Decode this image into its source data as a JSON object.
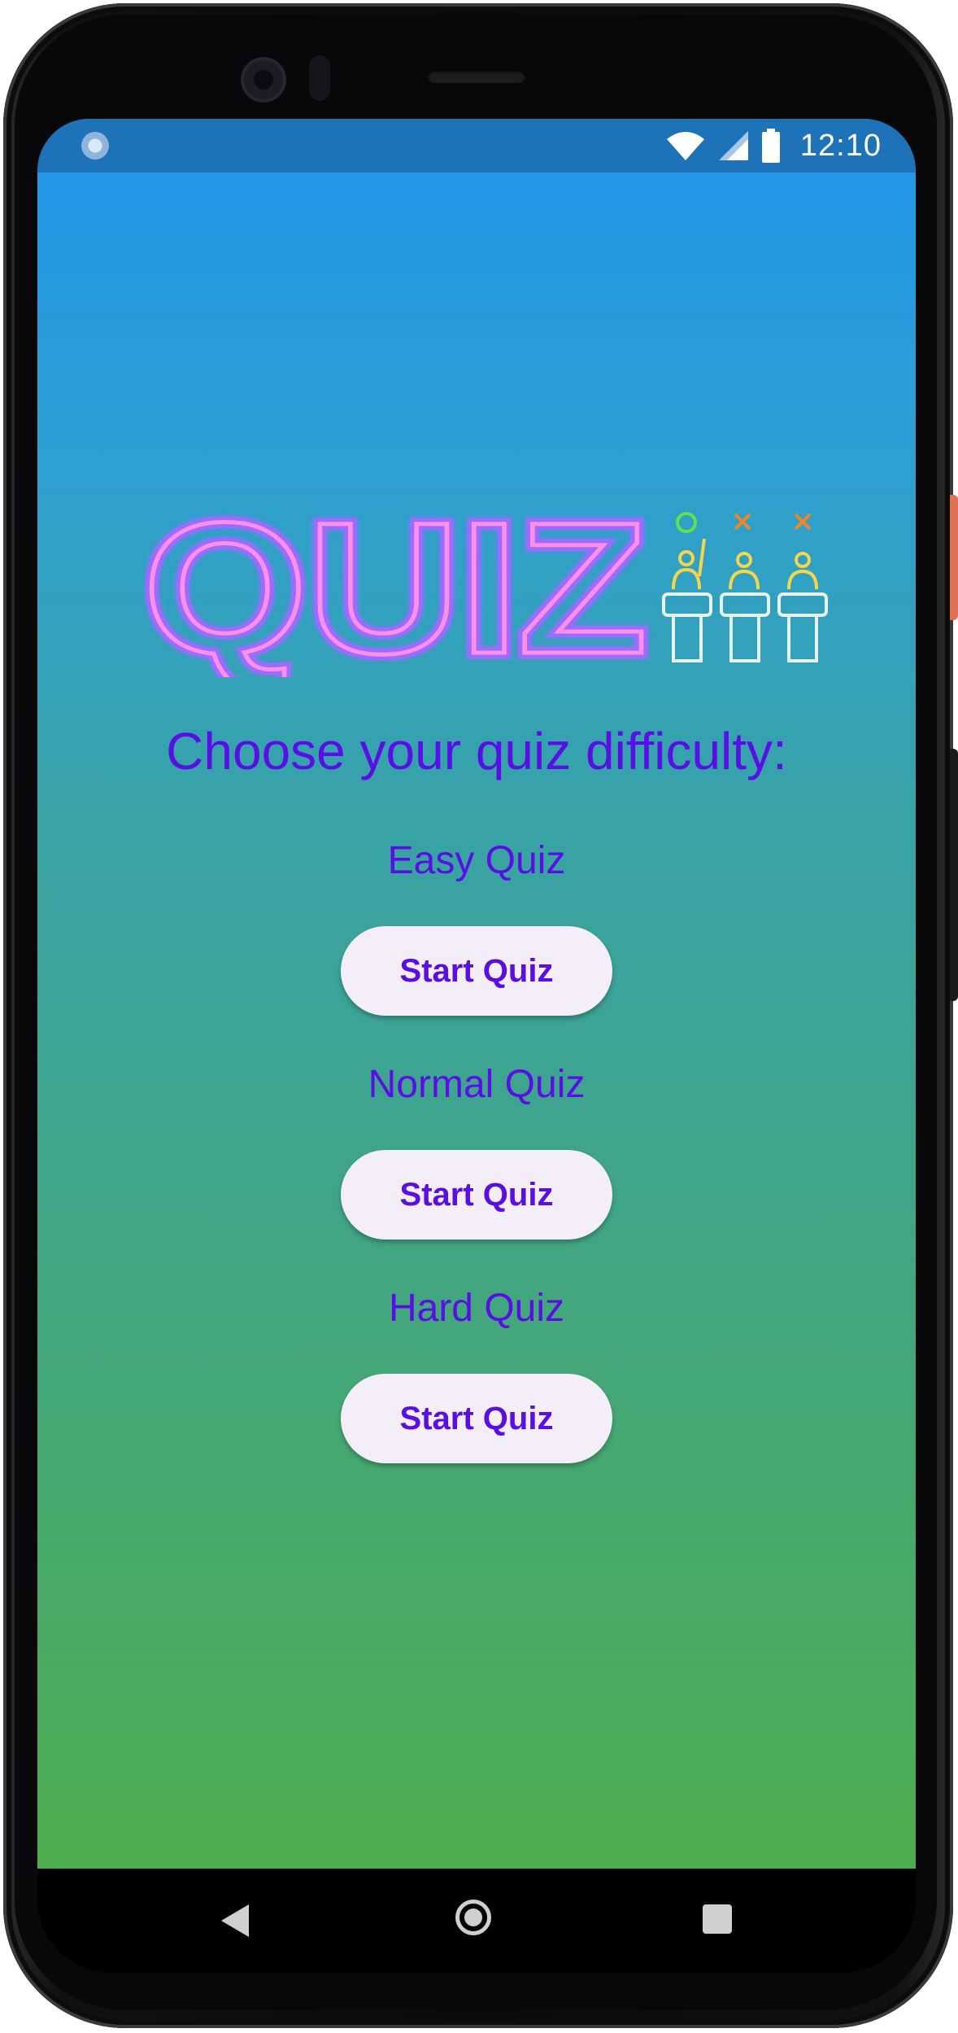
{
  "status_bar": {
    "time": "12:10",
    "icons": [
      "wifi-icon",
      "cellular-signal-icon",
      "battery-icon"
    ]
  },
  "logo": {
    "text": "QUIZ"
  },
  "main": {
    "title": "Choose your quiz difficulty:",
    "levels": [
      {
        "label": "Easy Quiz",
        "button": "Start Quiz"
      },
      {
        "label": "Normal Quiz",
        "button": "Start Quiz"
      },
      {
        "label": "Hard Quiz",
        "button": "Start Quiz"
      }
    ]
  },
  "nav_bar": {
    "icons": [
      "back-icon",
      "home-icon",
      "recents-icon"
    ]
  },
  "colors": {
    "accent": "#5a0ee6",
    "button_bg": "#f3eef7",
    "status_bar": "#1d72b8",
    "gradient_top": "#2395ec",
    "gradient_bottom": "#4cad4e",
    "neon_pink": "#ff6fd8",
    "neon_purple": "#9b6cff"
  }
}
